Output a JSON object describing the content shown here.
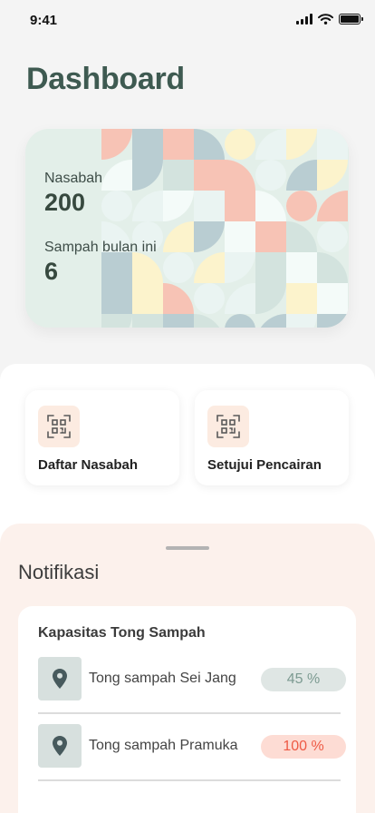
{
  "status_bar": {
    "time": "9:41"
  },
  "page_title": "Dashboard",
  "stats": [
    {
      "label": "Nasabah",
      "value": "200"
    },
    {
      "label": "Sampah bulan ini",
      "value": "6"
    }
  ],
  "actions": [
    {
      "label": "Daftar Nasabah",
      "icon": "qr-scan-icon"
    },
    {
      "label": "Setujui Pencairan",
      "icon": "qr-scan-icon"
    }
  ],
  "notifications": {
    "title": "Notifikasi",
    "card_title": "Kapasitas Tong Sampah",
    "bins": [
      {
        "name": "Tong sampah Sei Jang",
        "capacity": "45 %",
        "capacity_fraction": 0.45,
        "status_color": "#7d9b92",
        "badge_bg": "#dfe6e4",
        "icon": "location-pin-icon"
      },
      {
        "name": "Tong sampah Pramuka",
        "capacity": "100 %",
        "capacity_fraction": 1.0,
        "status_color": "#ee5a45",
        "badge_bg": "#fddcd4",
        "icon": "location-pin-icon"
      }
    ]
  },
  "colors": {
    "accent_dark": "#3e5a51",
    "pattern": [
      "#f7c3b5",
      "#fcf3cc",
      "#d3e3de",
      "#b9cdd2",
      "#eaf4f2",
      "#f4fbf9"
    ]
  }
}
